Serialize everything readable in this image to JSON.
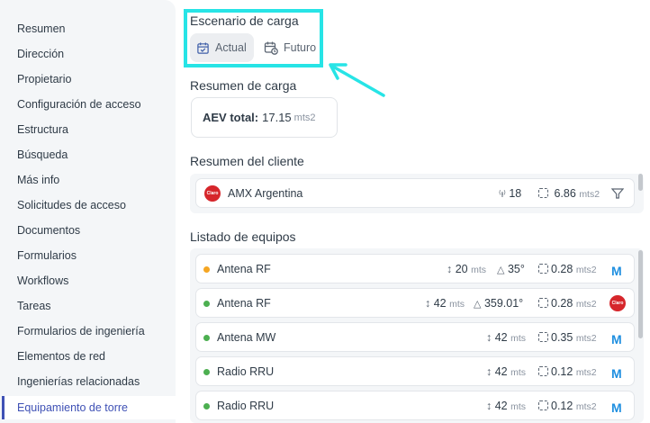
{
  "sidebar": {
    "items": [
      {
        "label": "Resumen"
      },
      {
        "label": "Dirección"
      },
      {
        "label": "Propietario"
      },
      {
        "label": "Configuración de acceso"
      },
      {
        "label": "Estructura"
      },
      {
        "label": "Búsqueda"
      },
      {
        "label": "Más info"
      },
      {
        "label": "Solicitudes de acceso"
      },
      {
        "label": "Documentos"
      },
      {
        "label": "Formularios"
      },
      {
        "label": "Workflows"
      },
      {
        "label": "Tareas"
      },
      {
        "label": "Formularios de ingeniería"
      },
      {
        "label": "Elementos de red"
      },
      {
        "label": "Ingenierías relacionadas"
      },
      {
        "label": "Equipamiento de torre"
      }
    ]
  },
  "scenario": {
    "title": "Escenario de carga",
    "tabs": [
      {
        "label": "Actual"
      },
      {
        "label": "Futuro"
      }
    ]
  },
  "load_summary": {
    "title": "Resumen de carga",
    "label": "AEV total:",
    "value": "17.15",
    "unit": "mts2"
  },
  "client_summary": {
    "title": "Resumen del cliente",
    "client": "AMX Argentina",
    "logo_text": "Claro",
    "antennas": "18",
    "area": "6.86",
    "area_unit": "mts2"
  },
  "equipment": {
    "title": "Listado de equipos",
    "rows": [
      {
        "name": "Antena RF",
        "status_color": "#f5a623",
        "height": "20",
        "height_unit": "mts",
        "angle": "35°",
        "area": "0.28",
        "area_unit": "mts2",
        "brand": "M"
      },
      {
        "name": "Antena RF",
        "status_color": "#4caf50",
        "height": "42",
        "height_unit": "mts",
        "angle": "359.01°",
        "area": "0.28",
        "area_unit": "mts2",
        "brand": "Claro"
      },
      {
        "name": "Antena MW",
        "status_color": "#4caf50",
        "height": "42",
        "height_unit": "mts",
        "angle": "",
        "area": "0.35",
        "area_unit": "mts2",
        "brand": "M"
      },
      {
        "name": "Radio RRU",
        "status_color": "#4caf50",
        "height": "42",
        "height_unit": "mts",
        "angle": "",
        "area": "0.12",
        "area_unit": "mts2",
        "brand": "M"
      },
      {
        "name": "Radio RRU",
        "status_color": "#4caf50",
        "height": "42",
        "height_unit": "mts",
        "angle": "",
        "area": "0.12",
        "area_unit": "mts2",
        "brand": "M"
      }
    ]
  },
  "colors": {
    "accent": "#3f51b5",
    "highlight": "#27e4e6",
    "brand_m": "#1f8fe0",
    "brand_claro": "#d6262b"
  }
}
